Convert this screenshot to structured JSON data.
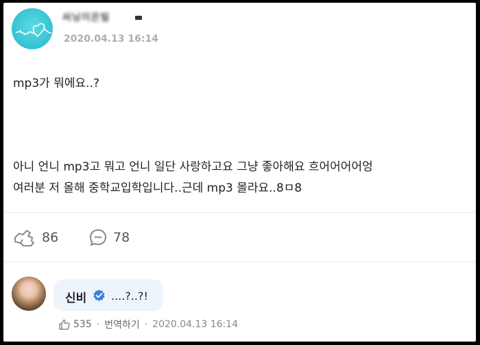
{
  "post": {
    "username": "씨닝이은빌",
    "timestamp": "2020.04.13 16:14",
    "lines": [
      "mp3가 뭐에요..?",
      "아니 언니 mp3고 뭐고 언니 일단 사랑하고요 그냥 좋아해요 흐어어어어엉",
      "여러분 저 올해 중학교입학입니다..근데 mp3 몰라요..8ㅁ8"
    ],
    "actions": {
      "like_count": "86",
      "comment_count": "78"
    }
  },
  "comment": {
    "author": "신비",
    "text": "....?..?!",
    "likes": "535",
    "separator": "·",
    "translate_label": "번역하기",
    "timestamp": "2020.04.13 16:14"
  },
  "colors": {
    "avatar_teal": "#33c2d4",
    "verified_blue": "#3b82d6",
    "bubble_bg": "#eef4fb"
  },
  "icons": [
    "heart-doodle-icon",
    "like-hand-icon",
    "comment-bubble-icon",
    "verified-check-icon",
    "thumbs-up-icon"
  ]
}
